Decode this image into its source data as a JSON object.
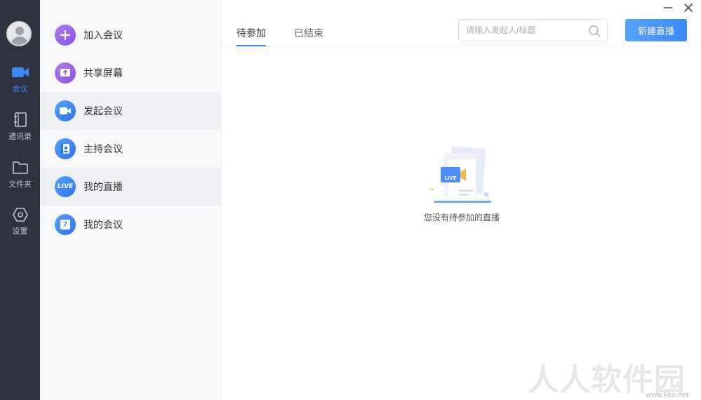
{
  "rail": {
    "items": [
      {
        "label": "会议",
        "icon": "video-camera-icon",
        "active": true
      },
      {
        "label": "通讯录",
        "icon": "contacts-book-icon"
      },
      {
        "label": "文件夹",
        "icon": "folder-icon"
      },
      {
        "label": "设置",
        "icon": "settings-hexagon-icon"
      }
    ]
  },
  "menu": {
    "items": [
      {
        "label": "加入会议",
        "icon": "plus-icon"
      },
      {
        "label": "共享屏幕",
        "icon": "share-screen-icon"
      },
      {
        "label": "发起会议",
        "icon": "video-icon"
      },
      {
        "label": "主持会议",
        "icon": "host-icon"
      },
      {
        "label": "我的直播",
        "icon": "live-icon",
        "badge": "LIVE"
      },
      {
        "label": "我的会议",
        "icon": "calendar-icon",
        "badge": "7"
      }
    ]
  },
  "main": {
    "tabs": [
      {
        "label": "待参加",
        "active": true
      },
      {
        "label": "已结束"
      }
    ],
    "search": {
      "placeholder": "请输入发起人/标题"
    },
    "new_button_label": "新建直播",
    "empty": {
      "text": "您没有待参加的直播",
      "illustration_badge": "LIVE"
    }
  },
  "watermark": {
    "big": "人人软件园",
    "small": "www.kkx.net"
  },
  "colors": {
    "accent": "#3b88f5",
    "rail_bg": "#2f3240",
    "purple": "#8752e6"
  }
}
